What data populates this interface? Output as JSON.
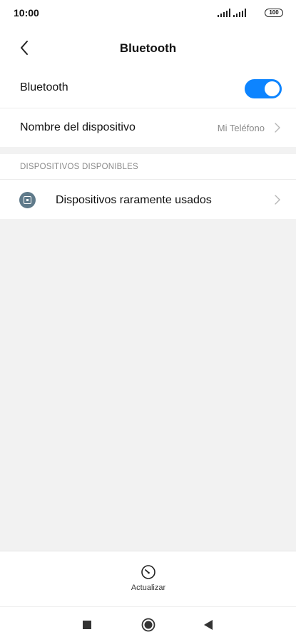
{
  "status_bar": {
    "time": "10:00",
    "battery": "100"
  },
  "header": {
    "title": "Bluetooth",
    "back_icon": "chevron-left-icon"
  },
  "settings": {
    "bluetooth": {
      "label": "Bluetooth",
      "enabled": true,
      "toggle_color": "#0d84ff"
    },
    "device_name": {
      "label": "Nombre del dispositivo",
      "value": "Mi Teléfono"
    }
  },
  "available_devices": {
    "section_title": "DISPOSITIVOS DISPONIBLES",
    "items": [
      {
        "label": "Dispositivos raramente usados",
        "icon": "device-square-icon"
      }
    ]
  },
  "action_bar": {
    "refresh_label": "Actualizar",
    "refresh_icon": "refresh-gauge-icon"
  },
  "nav_bar": {
    "recent_icon": "square-icon",
    "home_icon": "circle-icon",
    "back_icon": "triangle-back-icon"
  }
}
